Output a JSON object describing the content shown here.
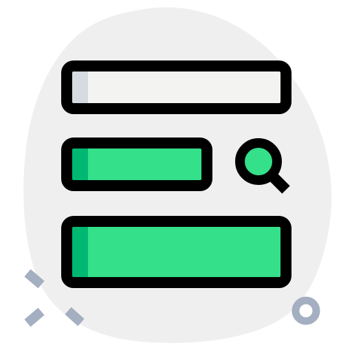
{
  "icon": {
    "name": "search-bar-form-icon",
    "style": "flat-outlined",
    "colors": {
      "blob": "#efefef",
      "outline": "#000000",
      "field_light_fill": "#f3f3f1",
      "field_light_shade": "#d5dbe1",
      "field_green_fill": "#34e089",
      "field_green_shade": "#00b871",
      "search_lens_fill": "#34e089",
      "decoration": "#a4afc1"
    },
    "elements": [
      "search-input-field",
      "search-query-field",
      "magnifier-icon",
      "results-panel"
    ],
    "decorations": [
      "sparkle-cross",
      "ring-circle"
    ]
  }
}
